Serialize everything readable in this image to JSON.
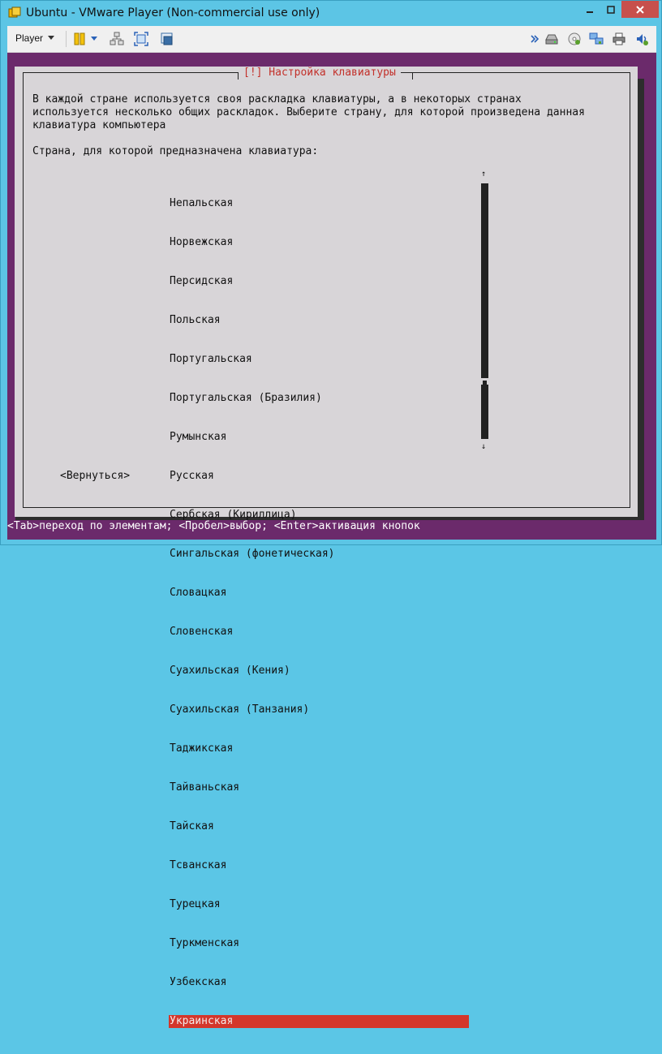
{
  "window": {
    "title": "Ubuntu - VMware Player (Non-commercial use only)",
    "controls": [
      "minimize",
      "maximize",
      "close"
    ]
  },
  "toolbar": {
    "player_label": "Player",
    "icons": [
      "pause-icon",
      "send-ctrl-alt-del-icon",
      "fullscreen-icon",
      "unity-icon",
      "more-icon",
      "hdd-icon",
      "cd-icon",
      "network-icon",
      "printer-icon",
      "sound-icon"
    ]
  },
  "dialog": {
    "title": "[!] Настройка клавиатуры",
    "description": "В каждой стране используется своя раскладка клавиатуры, а в некоторых странах\nиспользуется несколько общих раскладок. Выберите страну, для которой произведена данная\nклавиатура компьютера",
    "prompt": "Страна, для которой предназначена клавиатура:",
    "items": [
      "Непальская",
      "Норвежская",
      "Персидская",
      "Польская",
      "Португальская",
      "Португальская (Бразилия)",
      "Румынская",
      "Русская",
      "Сербская (Кириллица)",
      "Сингальская (фонетическая)",
      "Словацкая",
      "Словенская",
      "Суахильская (Кения)",
      "Суахильская (Танзания)",
      "Таджикская",
      "Тайваньская",
      "Тайская",
      "Тсванская",
      "Турецкая",
      "Туркменская",
      "Узбекская",
      "Украинская"
    ],
    "selected_index": 21,
    "scroll_up": "↑",
    "scroll_down": "↓",
    "back_button": "<Вернуться>"
  },
  "statusbar": {
    "text": "<Tab>переход по элементам; <Пробел>выбор; <Enter>активация кнопок"
  },
  "colors": {
    "window_frame": "#5cc5e5",
    "vm_background": "#6b2a6b",
    "dialog_background": "#d8d5d8",
    "accent_red": "#d4362b",
    "title_red": "#c3312b",
    "close_button": "#c7504c"
  }
}
